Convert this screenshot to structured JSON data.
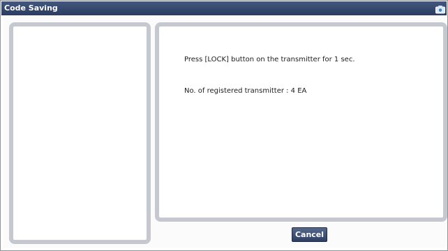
{
  "window": {
    "title": "Code Saving",
    "title_icon": "camera-icon"
  },
  "message": {
    "instruction": "Press [LOCK] button on the transmitter for 1 sec.",
    "registered": "No. of registered transmitter : 4 EA"
  },
  "buttons": {
    "cancel_label": "Cancel"
  },
  "colors": {
    "titlebar": "#34476c",
    "panel_border": "#c5c8ce",
    "button": "#3d4f74"
  }
}
